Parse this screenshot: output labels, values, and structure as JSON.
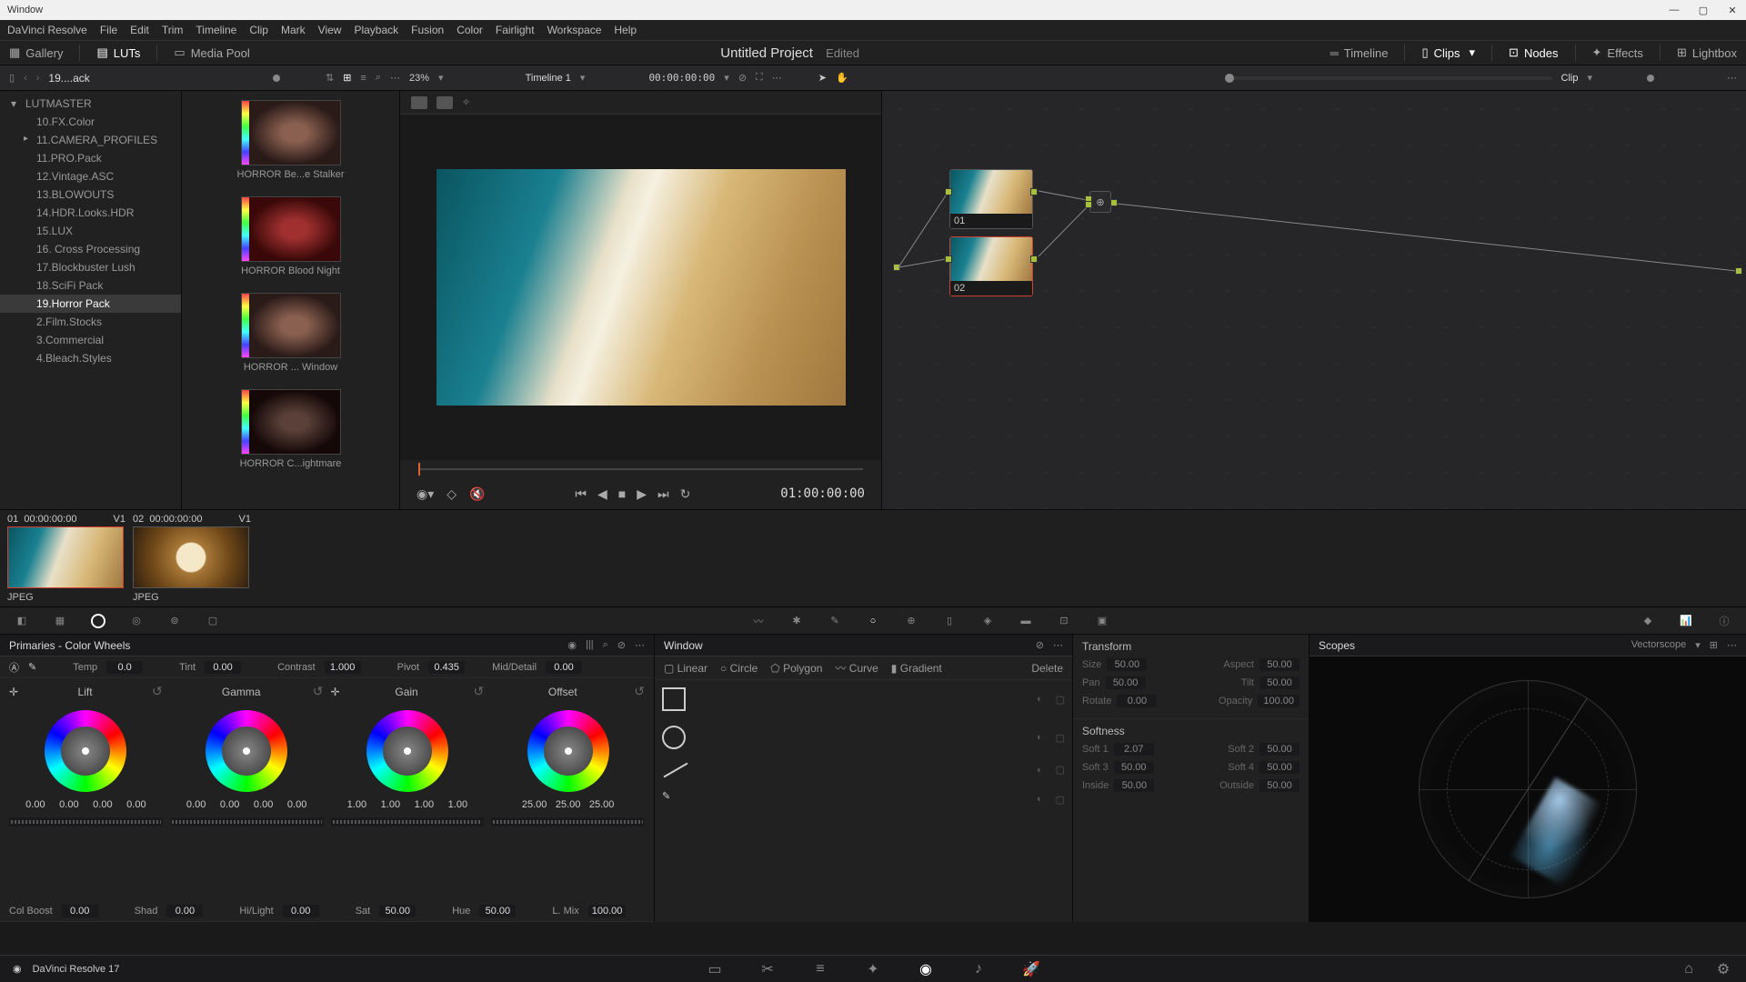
{
  "window": {
    "title": "Window",
    "tools": [
      "Linear",
      "Circle",
      "Polygon",
      "Curve",
      "Gradient",
      "Delete"
    ]
  },
  "menu": [
    "DaVinci Resolve",
    "File",
    "Edit",
    "Trim",
    "Timeline",
    "Clip",
    "Mark",
    "View",
    "Playback",
    "Fusion",
    "Color",
    "Fairlight",
    "Workspace",
    "Help"
  ],
  "toolbar": {
    "gallery": "Gallery",
    "luts": "LUTs",
    "mediapool": "Media Pool",
    "project_title": "Untitled Project",
    "project_status": "Edited",
    "timeline": "Timeline",
    "clips": "Clips",
    "nodes": "Nodes",
    "effects": "Effects",
    "lightbox": "Lightbox"
  },
  "subbar": {
    "crumb": "19....ack",
    "zoom": "23%",
    "timeline_name": "Timeline 1",
    "timecode": "00:00:00:00",
    "clip_mode": "Clip"
  },
  "tree": [
    {
      "label": "LUTMASTER",
      "cls": "expanded"
    },
    {
      "label": "10.FX.Color",
      "cls": "lvl1"
    },
    {
      "label": "11.CAMERA_PROFILES",
      "cls": "lvl1 collapsed"
    },
    {
      "label": "11.PRO.Pack",
      "cls": "lvl1"
    },
    {
      "label": "12.Vintage.ASC",
      "cls": "lvl1"
    },
    {
      "label": "13.BLOWOUTS",
      "cls": "lvl1"
    },
    {
      "label": "14.HDR.Looks.HDR",
      "cls": "lvl1"
    },
    {
      "label": "15.LUX",
      "cls": "lvl1"
    },
    {
      "label": "16. Cross Processing",
      "cls": "lvl1"
    },
    {
      "label": "17.Blockbuster Lush",
      "cls": "lvl1"
    },
    {
      "label": "18.SciFi Pack",
      "cls": "lvl1"
    },
    {
      "label": "19.Horror Pack",
      "cls": "lvl1 selected"
    },
    {
      "label": "2.Film.Stocks",
      "cls": "lvl1"
    },
    {
      "label": "3.Commercial",
      "cls": "lvl1"
    },
    {
      "label": "4.Bleach.Styles",
      "cls": "lvl1"
    }
  ],
  "gallery": [
    {
      "label": "HORROR  Be...e Stalker",
      "tone": ""
    },
    {
      "label": "HORROR Blood Night",
      "tone": "red"
    },
    {
      "label": "HORROR ... Window",
      "tone": ""
    },
    {
      "label": "HORROR C...ightmare",
      "tone": "dark"
    }
  ],
  "viewer": {
    "timecode": "01:00:00:00"
  },
  "nodes": {
    "n1": "01",
    "n2": "02"
  },
  "clips": [
    {
      "id": "01",
      "tc": "00:00:00:00",
      "track": "V1",
      "format": "JPEG",
      "style": "beach",
      "selected": true
    },
    {
      "id": "02",
      "tc": "00:00:00:00",
      "track": "V1",
      "format": "JPEG",
      "style": "coffee",
      "selected": false
    }
  ],
  "primaries": {
    "title": "Primaries - Color Wheels",
    "row1": {
      "temp_l": "Temp",
      "temp_v": "0.0",
      "tint_l": "Tint",
      "tint_v": "0.00",
      "contrast_l": "Contrast",
      "contrast_v": "1.000",
      "pivot_l": "Pivot",
      "pivot_v": "0.435",
      "md_l": "Mid/Detail",
      "md_v": "0.00"
    },
    "wheels": {
      "lift": {
        "name": "Lift",
        "v": [
          "0.00",
          "0.00",
          "0.00",
          "0.00"
        ]
      },
      "gamma": {
        "name": "Gamma",
        "v": [
          "0.00",
          "0.00",
          "0.00",
          "0.00"
        ]
      },
      "gain": {
        "name": "Gain",
        "v": [
          "1.00",
          "1.00",
          "1.00",
          "1.00"
        ]
      },
      "offset": {
        "name": "Offset",
        "v": [
          "25.00",
          "25.00",
          "25.00"
        ]
      }
    },
    "row2": {
      "cb_l": "Col Boost",
      "cb_v": "0.00",
      "shad_l": "Shad",
      "shad_v": "0.00",
      "hl_l": "Hi/Light",
      "hl_v": "0.00",
      "sat_l": "Sat",
      "sat_v": "50.00",
      "hue_l": "Hue",
      "hue_v": "50.00",
      "lm_l": "L. Mix",
      "lm_v": "100.00"
    }
  },
  "transform": {
    "title": "Transform",
    "fields": {
      "size_l": "Size",
      "size_v": "50.00",
      "aspect_l": "Aspect",
      "aspect_v": "50.00",
      "pan_l": "Pan",
      "pan_v": "50.00",
      "tilt_l": "Tilt",
      "tilt_v": "50.00",
      "rotate_l": "Rotate",
      "rotate_v": "0.00",
      "opacity_l": "Opacity",
      "opacity_v": "100.00"
    },
    "softness_title": "Softness",
    "soft": {
      "s1_l": "Soft 1",
      "s1_v": "2.07",
      "s2_l": "Soft 2",
      "s2_v": "50.00",
      "s3_l": "Soft 3",
      "s3_v": "50.00",
      "s4_l": "Soft 4",
      "s4_v": "50.00",
      "in_l": "Inside",
      "in_v": "50.00",
      "out_l": "Outside",
      "out_v": "50.00"
    }
  },
  "scopes": {
    "title": "Scopes",
    "type": "Vectorscope"
  },
  "footer": {
    "app": "DaVinci Resolve 17"
  }
}
